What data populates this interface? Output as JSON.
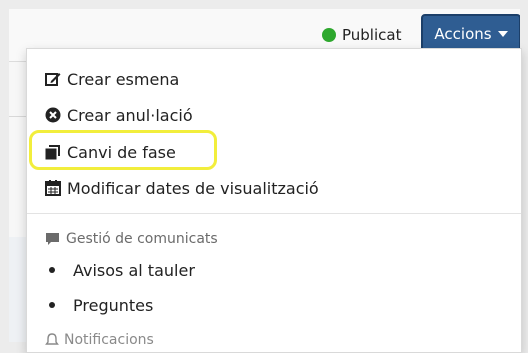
{
  "header": {
    "status_label": "Publicat",
    "status_color": "#2ea82e",
    "actions_button": "Accions",
    "actions_color": "#2f5d92"
  },
  "menu": {
    "items": [
      {
        "label": "Crear esmena",
        "icon": "edit-icon"
      },
      {
        "label": "Crear anul·lació",
        "icon": "times-circle-icon"
      },
      {
        "label": "Canvi de fase",
        "icon": "clone-icon",
        "highlighted": true
      },
      {
        "label": "Modificar dates de visualització",
        "icon": "calendar-icon"
      }
    ],
    "section_header": {
      "label": "Gestió de comunicats",
      "icon": "comment-icon"
    },
    "bullets": [
      "Avisos al tauler",
      "Preguntes"
    ],
    "partial_item": {
      "label": "Notificacions",
      "icon": "bell-icon"
    }
  },
  "highlight_color": "#f2ee3c"
}
